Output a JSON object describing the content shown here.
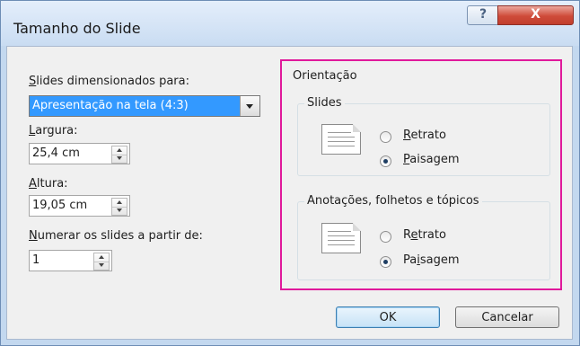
{
  "window": {
    "title": "Tamanho do Slide",
    "help_glyph": "?",
    "close_glyph": "X"
  },
  "left": {
    "slides_for_label_key": "S",
    "slides_for_label_rest": "lides dimensionados para:",
    "slides_for_value": "Apresentação na tela (4:3)",
    "width_label_key": "L",
    "width_label_rest": "argura:",
    "width_value": "25,4 cm",
    "height_label_key": "A",
    "height_label_rest": "ltura:",
    "height_value": "19,05 cm",
    "number_label_key": "N",
    "number_label_rest": "umerar os slides a partir de:",
    "number_value": "1"
  },
  "orientation": {
    "title": "Orientação",
    "slides": {
      "title": "Slides",
      "portrait_key": "R",
      "portrait_rest": "etrato",
      "landscape_key": "P",
      "landscape_rest": "aisagem",
      "selected": "landscape"
    },
    "notes": {
      "title": "Anotações, folhetos e tópicos",
      "portrait_pre": "R",
      "portrait_key": "e",
      "portrait_rest": "trato",
      "landscape_pre": "Pa",
      "landscape_key": "i",
      "landscape_rest": "sagem",
      "selected": "landscape"
    }
  },
  "buttons": {
    "ok": "OK",
    "cancel": "Cancelar"
  },
  "colors": {
    "highlight": "#e0199b",
    "selection": "#3399ff",
    "close_button": "#cf4b3a"
  }
}
